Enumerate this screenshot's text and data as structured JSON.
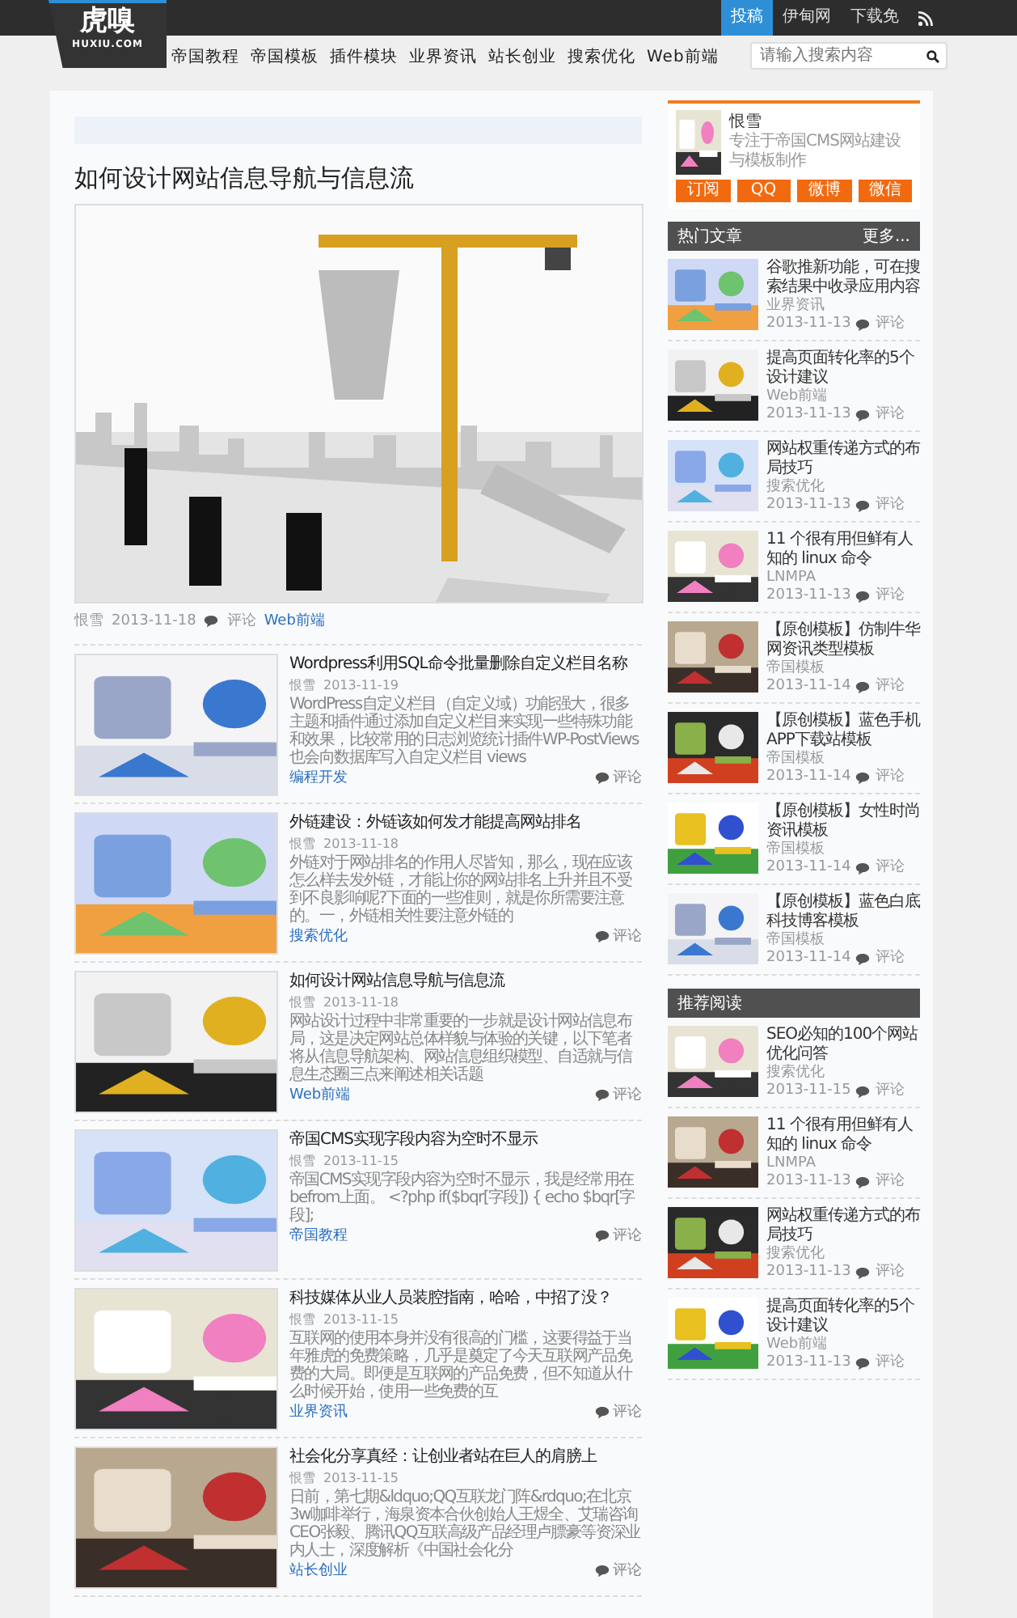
{
  "top_bar": {
    "links": [
      {
        "label": "投稿",
        "selected": true
      },
      {
        "label": "伊甸网",
        "selected": false
      },
      {
        "label": "下载免",
        "selected": false
      }
    ]
  },
  "logo": {
    "name": "虎嗅",
    "domain": "HUXIU.COM"
  },
  "nav": [
    "帝国教程",
    "帝国模板",
    "插件模块",
    "业界资讯",
    "站长创业",
    "搜索优化",
    "Web前端"
  ],
  "search": {
    "placeholder": "请输入搜索内容"
  },
  "featured": {
    "title": "如何设计网站信息导航与信息流",
    "author": "恨雪",
    "date": "2013-11-18",
    "comments": "评论",
    "category": "Web前端"
  },
  "articles": [
    {
      "title": "Wordpress利用SQL命令批量删除自定义栏目名称",
      "author": "恨雪",
      "date": "2013-11-19",
      "excerpt": "WordPress自定义栏目（自定义域）功能强大，很多主题和插件通过添加自定义栏目来实现一些特殊功能和效果，比较常用的日志浏览统计插件WP-PostViews也会向数据库写入自定义栏目 views",
      "category": "编程开发",
      "comments": "评论"
    },
    {
      "title": "外链建设：外链该如何发才能提高网站排名",
      "author": "恨雪",
      "date": "2013-11-18",
      "excerpt": "外链对于网站排名的作用人尽皆知，那么，现在应该怎么样去发外链，才能让你的网站排名上升并且不受到不良影响呢?下面的一些准则，就是你所需要注意的。一，外链相关性要注意外链的",
      "category": "搜索优化",
      "comments": "评论"
    },
    {
      "title": "如何设计网站信息导航与信息流",
      "author": "恨雪",
      "date": "2013-11-18",
      "excerpt": "网站设计过程中非常重要的一步就是设计网站信息布局，这是决定网站总体样貌与体验的关键，以下笔者将从信息导航架构、网站信息组织模型、自适就与信息生态圈三点来阐述相关话题",
      "category": "Web前端",
      "comments": "评论"
    },
    {
      "title": "帝国CMS实现字段内容为空时不显示",
      "author": "恨雪",
      "date": "2013-11-15",
      "excerpt": "帝国CMS实现字段内容为空时不显示，我是经常用在befrom上面。 <?php if($bqr[字段]) { echo $bqr[字段];",
      "category": "帝国教程",
      "comments": "评论"
    },
    {
      "title": "科技媒体从业人员装腔指南，哈哈，中招了没？",
      "author": "恨雪",
      "date": "2013-11-15",
      "excerpt": "互联网的使用本身并没有很高的门槛，这要得益于当年雅虎的免费策略，几乎是奠定了今天互联网产品免费的大局。即便是互联网的产品免费，但不知道从什么时候开始，使用一些免费的互",
      "category": "业界资讯",
      "comments": "评论"
    },
    {
      "title": "社会化分享真经：让创业者站在巨人的肩膀上",
      "author": "恨雪",
      "date": "2013-11-15",
      "excerpt": "日前，第七期&ldquo;QQ互联龙门阵&rdquo;在北京3w咖啡举行，海泉资本合伙创始人王煜全、艾瑞咨询CEO张毅、腾讯QQ互联高级产品经理卢膘豪等资深业内人士，深度解析《中国社会化分",
      "category": "站长创业",
      "comments": "评论"
    }
  ],
  "profile": {
    "name": "恨雪",
    "bio": "专注于帝国CMS网站建设与模板制作",
    "buttons": [
      "订阅",
      "QQ",
      "微博",
      "微信"
    ]
  },
  "hot": {
    "title": "热门文章",
    "more": "更多...",
    "items": [
      {
        "title": "谷歌推新功能，可在搜索结果中收录应用内容",
        "category": "业界资讯",
        "date": "2013-11-13",
        "comments": "评论"
      },
      {
        "title": "提高页面转化率的5个设计建议",
        "category": "Web前端",
        "date": "2013-11-13",
        "comments": "评论"
      },
      {
        "title": "网站权重传递方式的布局技巧",
        "category": "搜索优化",
        "date": "2013-11-13",
        "comments": "评论"
      },
      {
        "title": "11 个很有用但鲜有人知的 linux 命令",
        "category": "LNMPA",
        "date": "2013-11-13",
        "comments": "评论"
      },
      {
        "title": "【原创模板】仿制牛华网资讯类型模板",
        "category": "帝国模板",
        "date": "2013-11-14",
        "comments": "评论"
      },
      {
        "title": "【原创模板】蓝色手机APP下载站模板",
        "category": "帝国模板",
        "date": "2013-11-14",
        "comments": "评论"
      },
      {
        "title": "【原创模板】女性时尚资讯模板",
        "category": "帝国模板",
        "date": "2013-11-14",
        "comments": "评论"
      },
      {
        "title": "【原创模板】蓝色白底科技博客模板",
        "category": "帝国模板",
        "date": "2013-11-14",
        "comments": "评论"
      }
    ]
  },
  "recommended": {
    "title": "推荐阅读",
    "items": [
      {
        "title": "SEO必知的100个网站优化问答",
        "category": "搜索优化",
        "date": "2013-11-15",
        "comments": "评论"
      },
      {
        "title": "11 个很有用但鲜有人知的 linux 命令",
        "category": "LNMPA",
        "date": "2013-11-13",
        "comments": "评论"
      },
      {
        "title": "网站权重传递方式的布局技巧",
        "category": "搜索优化",
        "date": "2013-11-13",
        "comments": "评论"
      },
      {
        "title": "提高页面转化率的5个设计建议",
        "category": "Web前端",
        "date": "2013-11-13",
        "comments": "评论"
      }
    ]
  }
}
